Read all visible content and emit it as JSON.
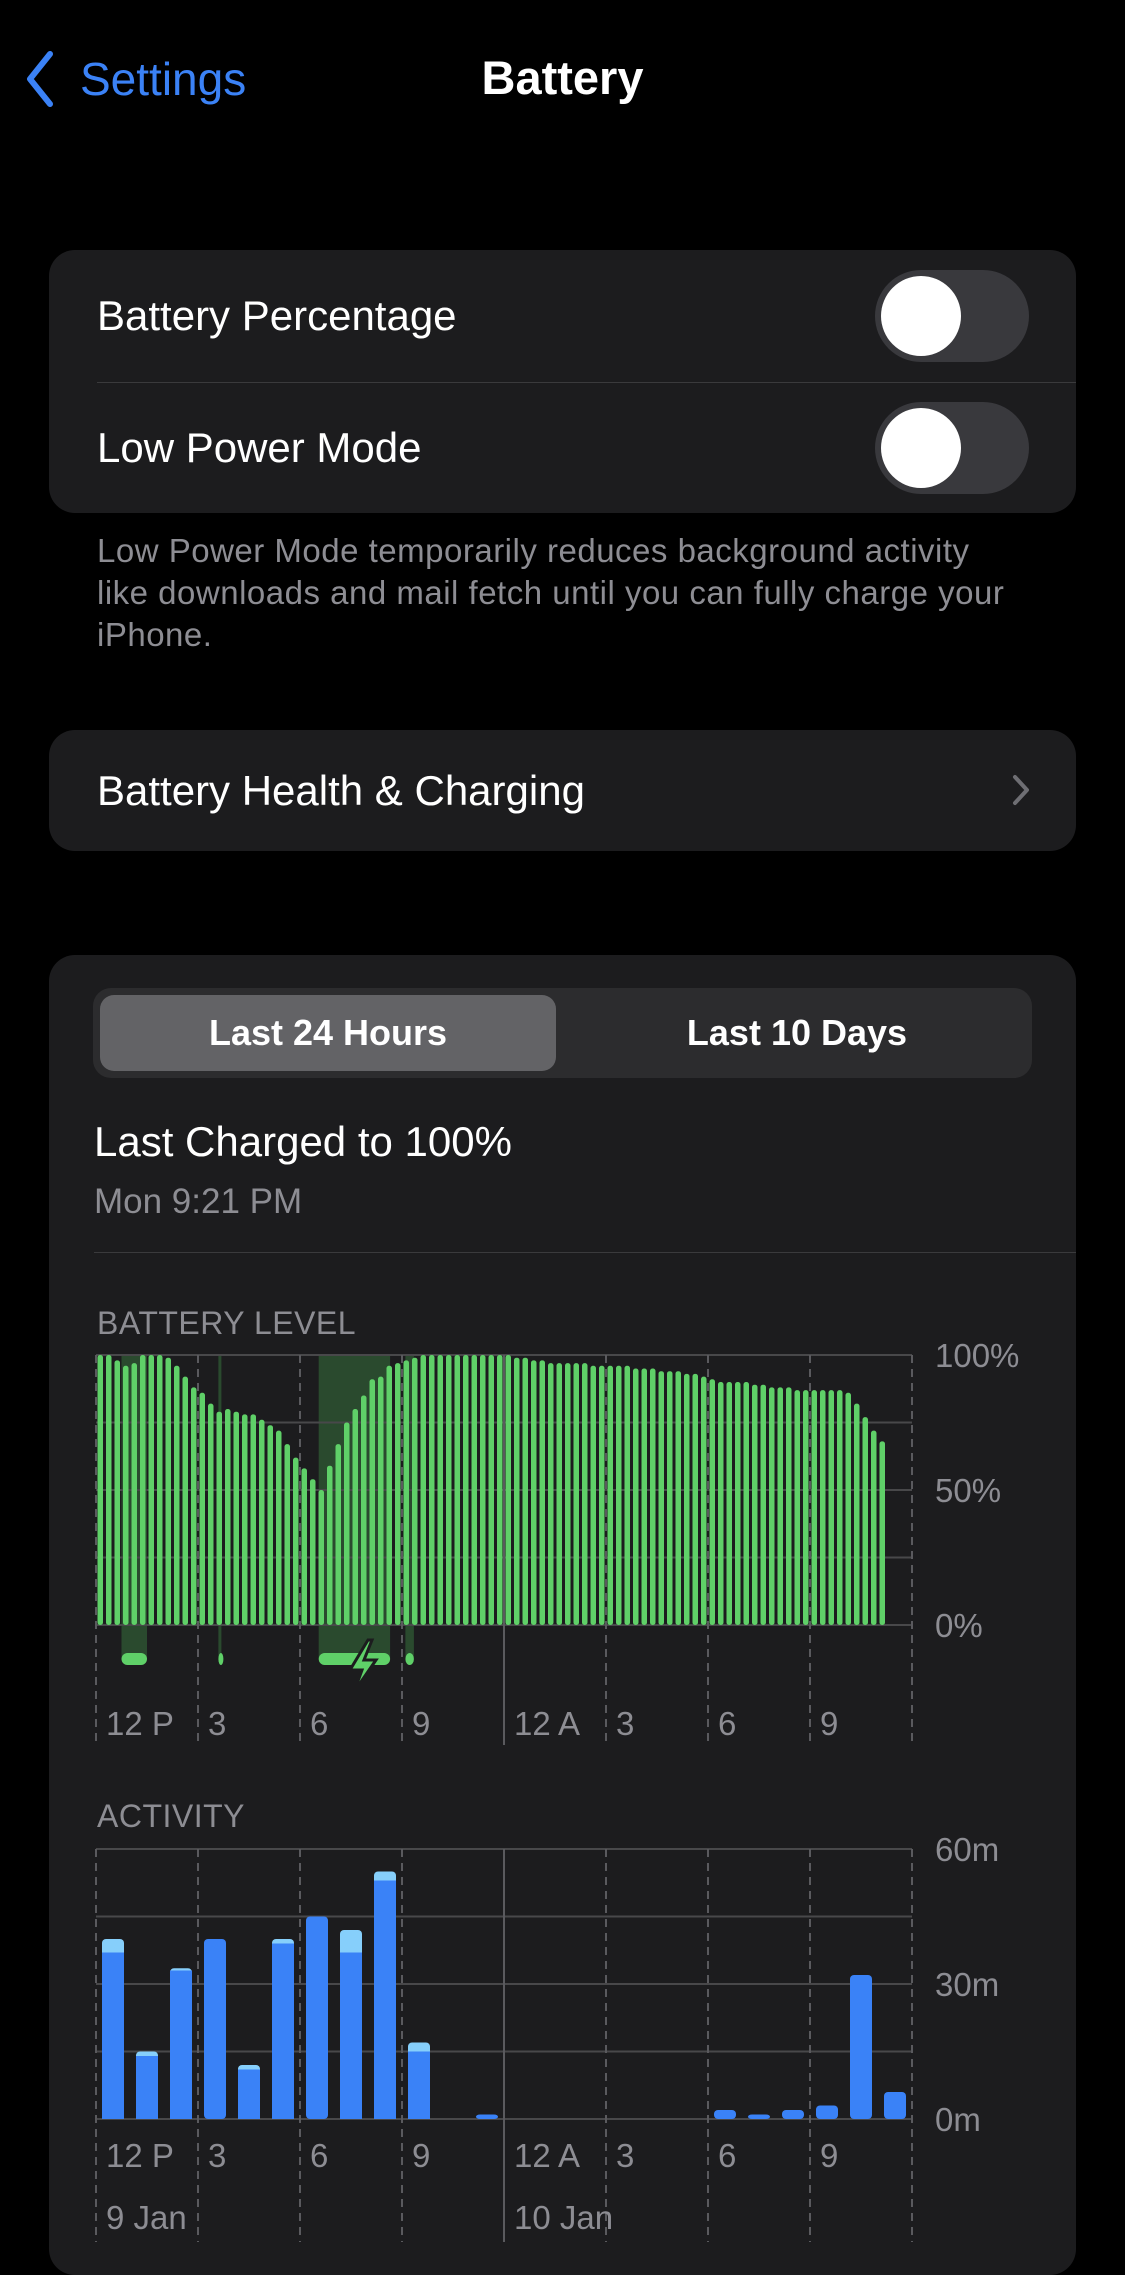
{
  "nav": {
    "back_label": "Settings",
    "title": "Battery"
  },
  "toggles": [
    {
      "label": "Battery Percentage",
      "on": false
    },
    {
      "label": "Low Power Mode",
      "on": false
    }
  ],
  "low_power_footer": "Low Power Mode temporarily reduces background activity like downloads and mail fetch until you can fully charge your iPhone.",
  "health_row": {
    "label": "Battery Health & Charging"
  },
  "usage": {
    "tabs": [
      {
        "label": "Last 24 Hours",
        "selected": true
      },
      {
        "label": "Last 10 Days",
        "selected": false
      }
    ],
    "last_charged": "Last Charged to 100%",
    "last_charged_time": "Mon 9:21 PM"
  },
  "colors": {
    "accent": "#3b82f6",
    "battery_green": "#5fd068",
    "charging_shade": "#2a4a2e",
    "screen_on": "#3a82f7",
    "screen_off": "#86cffb"
  },
  "chart_data": [
    {
      "type": "bar",
      "title": "BATTERY LEVEL",
      "x_tick_labels": [
        "12 P",
        "3",
        "6",
        "9",
        "12 A",
        "3",
        "6",
        "9"
      ],
      "y_tick_labels": [
        "100%",
        "50%",
        "0%"
      ],
      "ylim": [
        0,
        100
      ],
      "interval_minutes": 15,
      "values": [
        100,
        100,
        98,
        96,
        97,
        100,
        100,
        100,
        99,
        96,
        92,
        88,
        86,
        82,
        79,
        80,
        79,
        78,
        78,
        76,
        74,
        72,
        67,
        62,
        58,
        54,
        50,
        59,
        67,
        75,
        80,
        85,
        91,
        92,
        96,
        97,
        98,
        99,
        100,
        100,
        100,
        100,
        100,
        100,
        100,
        100,
        100,
        100,
        100,
        99,
        99,
        98,
        98,
        97,
        97,
        97,
        97,
        97,
        96,
        96,
        96,
        96,
        96,
        95,
        95,
        95,
        94,
        94,
        94,
        93,
        93,
        92,
        91,
        90,
        90,
        90,
        90,
        89,
        89,
        88,
        88,
        88,
        87,
        87,
        87,
        87,
        87,
        87,
        86,
        82,
        77,
        72,
        68
      ],
      "charging_periods_hours_after_12P": [
        [
          0.75,
          1.5
        ],
        [
          3.6,
          3.65
        ],
        [
          6.55,
          8.65
        ],
        [
          9.1,
          9.35
        ]
      ]
    },
    {
      "type": "bar",
      "title": "ACTIVITY",
      "x_tick_labels": [
        "12 P",
        "3",
        "6",
        "9",
        "12 A",
        "3",
        "6",
        "9"
      ],
      "date_labels": [
        "9 Jan",
        "10 Jan"
      ],
      "y_tick_labels": [
        "60m",
        "30m",
        "0m"
      ],
      "ylim": [
        0,
        60
      ],
      "unit": "minutes",
      "series": [
        {
          "key": "screen_on",
          "values": [
            37,
            14,
            33,
            40,
            11,
            39,
            45,
            37,
            53,
            15,
            0,
            1,
            0,
            0,
            0,
            0,
            0,
            0,
            2,
            1,
            2,
            3,
            32,
            6
          ]
        },
        {
          "key": "screen_off",
          "values": [
            3,
            1,
            0.5,
            0,
            1,
            1,
            0,
            5,
            2,
            2,
            0,
            0,
            0,
            0,
            0,
            0,
            0,
            0,
            0,
            0,
            0,
            0,
            0,
            0
          ]
        }
      ]
    }
  ]
}
